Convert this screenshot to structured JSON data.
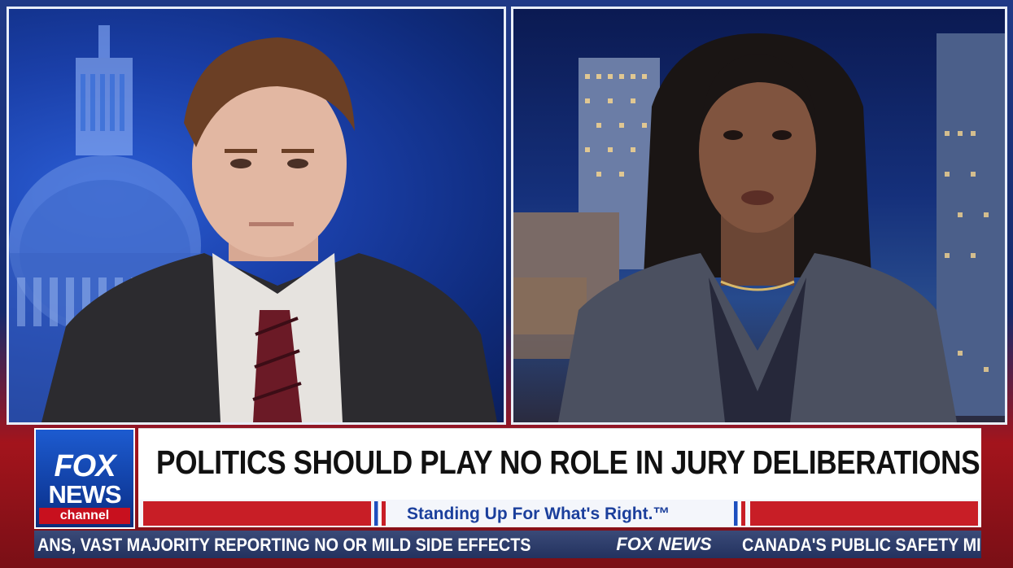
{
  "logo": {
    "line1": "FOX",
    "line2": "NEWS",
    "line3": "channel"
  },
  "headline": "POLITICS SHOULD PLAY NO ROLE IN JURY DELIBERATIONS",
  "tagline": "Standing Up For What's Right.™",
  "ticker": {
    "left_text": "ANS, VAST MAJORITY REPORTING NO OR MILD SIDE EFFECTS",
    "logo_text": "FOX NEWS",
    "right_text": "CANADA'S PUBLIC SAFETY MI"
  },
  "colors": {
    "brand_red": "#c81e26",
    "brand_blue": "#1d4fbf",
    "panel_border": "#e9eef8"
  }
}
